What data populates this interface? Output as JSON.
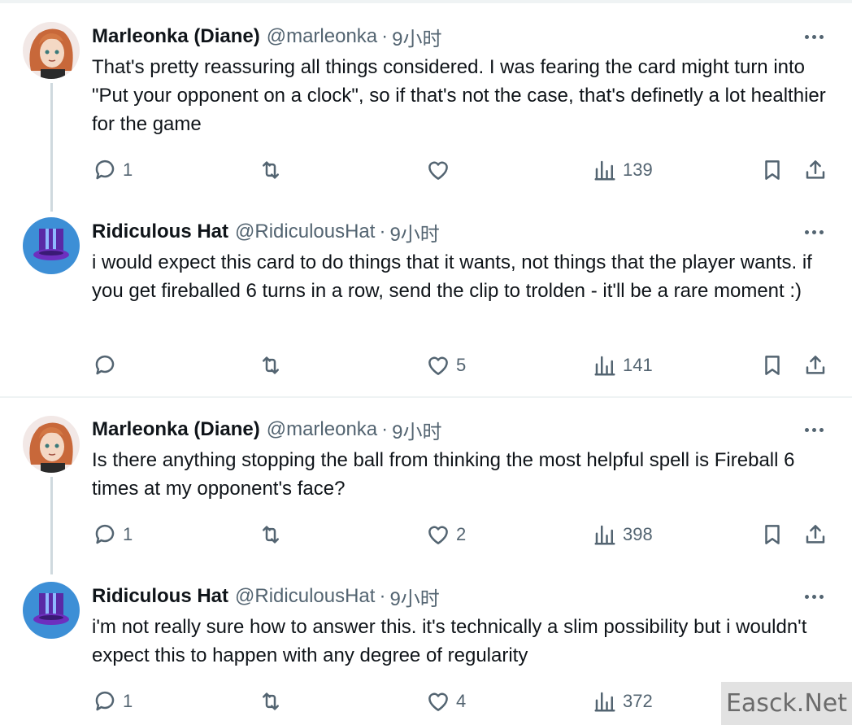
{
  "watermark": "Easck.Net",
  "tweets": [
    {
      "name": "Marleonka (Diane)",
      "handle": "@marleonka",
      "separator": "·",
      "time": "9小时",
      "text": "That's pretty reassuring all things considered. I was fearing the card might turn into \"Put your opponent on a clock\", so if that's not the case, that's definetly a lot healthier for the game",
      "replies": "1",
      "reposts": "",
      "likes": "",
      "views": "139"
    },
    {
      "name": "Ridiculous Hat",
      "handle": "@RidiculousHat",
      "separator": "·",
      "time": "9小时",
      "text": "i would expect this card to do things that it wants, not things that the player wants. if you get fireballed 6 turns in a row, send the clip to trolden - it'll be a rare moment :)",
      "replies": "",
      "reposts": "",
      "likes": "5",
      "views": "141"
    },
    {
      "name": "Marleonka (Diane)",
      "handle": "@marleonka",
      "separator": "·",
      "time": "9小时",
      "text": "Is there anything stopping the ball from thinking the most helpful spell is Fireball 6 times at my opponent's face?",
      "replies": "1",
      "reposts": "",
      "likes": "2",
      "views": "398"
    },
    {
      "name": "Ridiculous Hat",
      "handle": "@RidiculousHat",
      "separator": "·",
      "time": "9小时",
      "text": "i'm not really sure how to answer this. it's technically a slim possibility but i wouldn't expect this to happen with any degree of regularity",
      "replies": "1",
      "reposts": "",
      "likes": "4",
      "views": "372"
    }
  ]
}
